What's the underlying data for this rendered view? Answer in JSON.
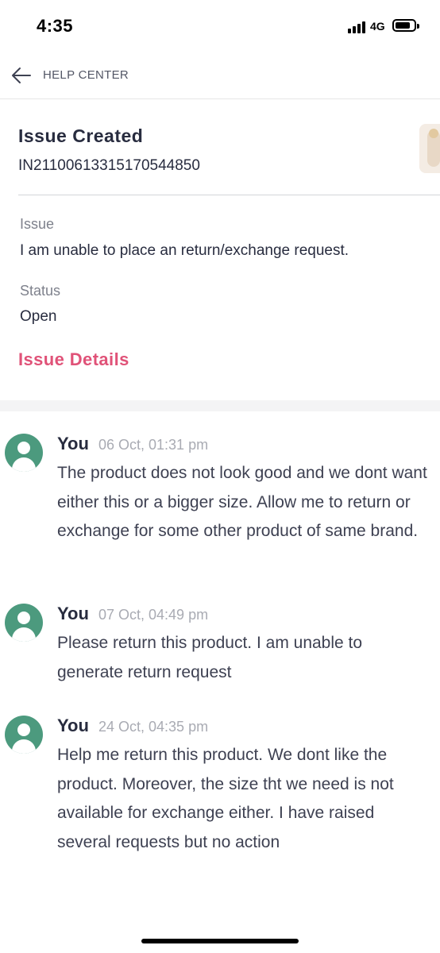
{
  "status_bar": {
    "time": "4:35",
    "network": "4G"
  },
  "nav": {
    "title": "HELP CENTER"
  },
  "issue": {
    "title": "Issue Created",
    "id": "IN21100613315170544850",
    "issue_label": "Issue",
    "issue_value": "I am unable to place an return/exchange request.",
    "status_label": "Status",
    "status_value": "Open",
    "details_link": "Issue Details"
  },
  "messages": [
    {
      "author": "You",
      "time": "06 Oct, 01:31 pm",
      "text": "The product does not look good and we dont want either this or a bigger size. Allow me to return or exchange for some other product of same brand."
    },
    {
      "author": "You",
      "time": "07 Oct, 04:49 pm",
      "text": "Please return this product. I am unable to generate return request"
    },
    {
      "author": "You",
      "time": "24 Oct, 04:35 pm",
      "text": "Help me return this product. We dont like the product. Moreover, the size tht we need is not available for exchange either. I have raised several requests but no action"
    }
  ],
  "colors": {
    "accent": "#e05278",
    "avatar": "#4c9a7e"
  },
  "icons": [
    "back-arrow-icon",
    "signal-icon",
    "battery-icon",
    "user-avatar-icon"
  ]
}
